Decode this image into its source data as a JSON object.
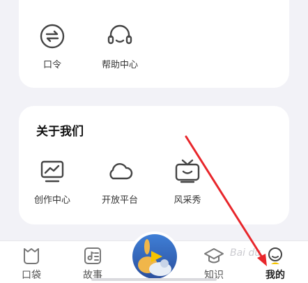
{
  "top_card": {
    "items": [
      {
        "label": "口令",
        "icon": "swap-circle-icon"
      },
      {
        "label": "帮助中心",
        "icon": "headset-icon"
      }
    ]
  },
  "about": {
    "title": "关于我们",
    "items": [
      {
        "label": "创作中心",
        "icon": "monitor-chart-icon"
      },
      {
        "label": "开放平台",
        "icon": "cloud-icon"
      },
      {
        "label": "风采秀",
        "icon": "tv-icon"
      }
    ]
  },
  "tabbar": {
    "tabs": [
      {
        "label": "口袋",
        "icon": "pocket-icon"
      },
      {
        "label": "故事",
        "icon": "story-book-icon"
      },
      {
        "label": "知识",
        "icon": "graduation-cap-icon"
      },
      {
        "label": "我的",
        "icon": "profile-icon"
      }
    ],
    "active": "我的",
    "center": {
      "icon": "play-icon"
    }
  },
  "watermark": "Bai du",
  "colors": {
    "background": "#f2f2f7",
    "card": "#ffffff",
    "annotation_arrow": "#e8262b",
    "play_yellow": "#f5c400"
  }
}
